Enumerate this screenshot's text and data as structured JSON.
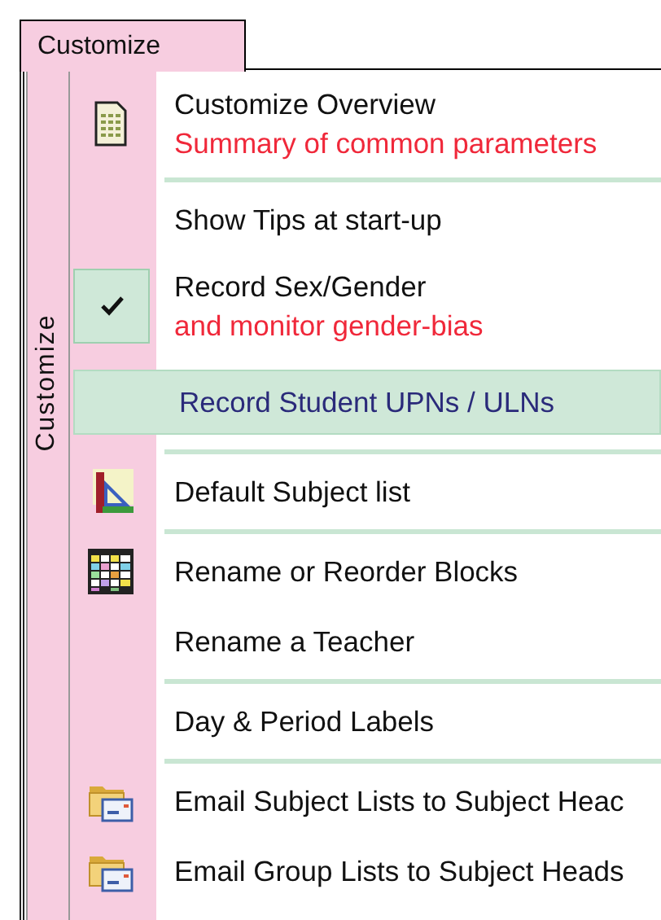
{
  "tab": {
    "label": "Customize",
    "selected": true
  },
  "rail": {
    "label": "Customize"
  },
  "groups": [
    {
      "items": [
        {
          "label": "Customize Overview",
          "subtitle": "Summary of common parameters",
          "kind": "document",
          "checked": false,
          "selected": false
        }
      ]
    },
    {
      "items": [
        {
          "label": "Show Tips at start-up",
          "checked": false,
          "selected": false
        },
        {
          "label": "Record Sex/Gender",
          "subtitle": "and monitor gender-bias",
          "checked": true,
          "selected": false
        },
        {
          "label": "Record Student UPNs / ULNs",
          "checked": false,
          "selected": true
        }
      ]
    },
    {
      "items": [
        {
          "label": "Default Subject list",
          "kind": "ruler",
          "checked": false,
          "selected": false
        }
      ]
    },
    {
      "items": [
        {
          "label": "Rename or Reorder Blocks",
          "kind": "grid",
          "checked": false,
          "selected": false
        },
        {
          "label": "Rename a Teacher",
          "checked": false,
          "selected": false
        }
      ]
    },
    {
      "items": [
        {
          "label": "Day & Period Labels",
          "checked": false,
          "selected": false
        }
      ]
    },
    {
      "items": [
        {
          "label": "Email Subject Lists to Subject Heac",
          "kind": "folder-mail",
          "checked": false,
          "selected": false
        },
        {
          "label": "Email Group Lists to Subject Heads",
          "kind": "folder-mail",
          "checked": false,
          "selected": false
        }
      ]
    }
  ]
}
